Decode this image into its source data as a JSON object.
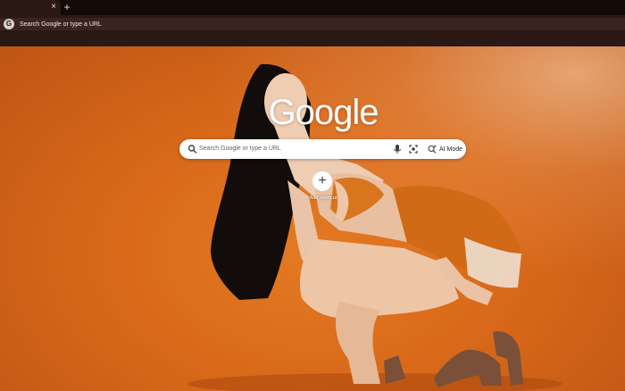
{
  "tabs": {
    "close_label": "×",
    "new_tab_label": "+"
  },
  "omnibox": {
    "icon_label": "G",
    "placeholder": "Search Google or type a URL"
  },
  "ntp": {
    "logo": "Google",
    "search_placeholder": "Search Google or type a URL",
    "ai_mode_label": "AI Mode",
    "add_shortcut_label": "Add shortcut",
    "add_shortcut_icon": "+"
  },
  "colors": {
    "background_orange": "#d9691a",
    "toolbar": "#2a1814",
    "tabstrip": "#140b09"
  }
}
